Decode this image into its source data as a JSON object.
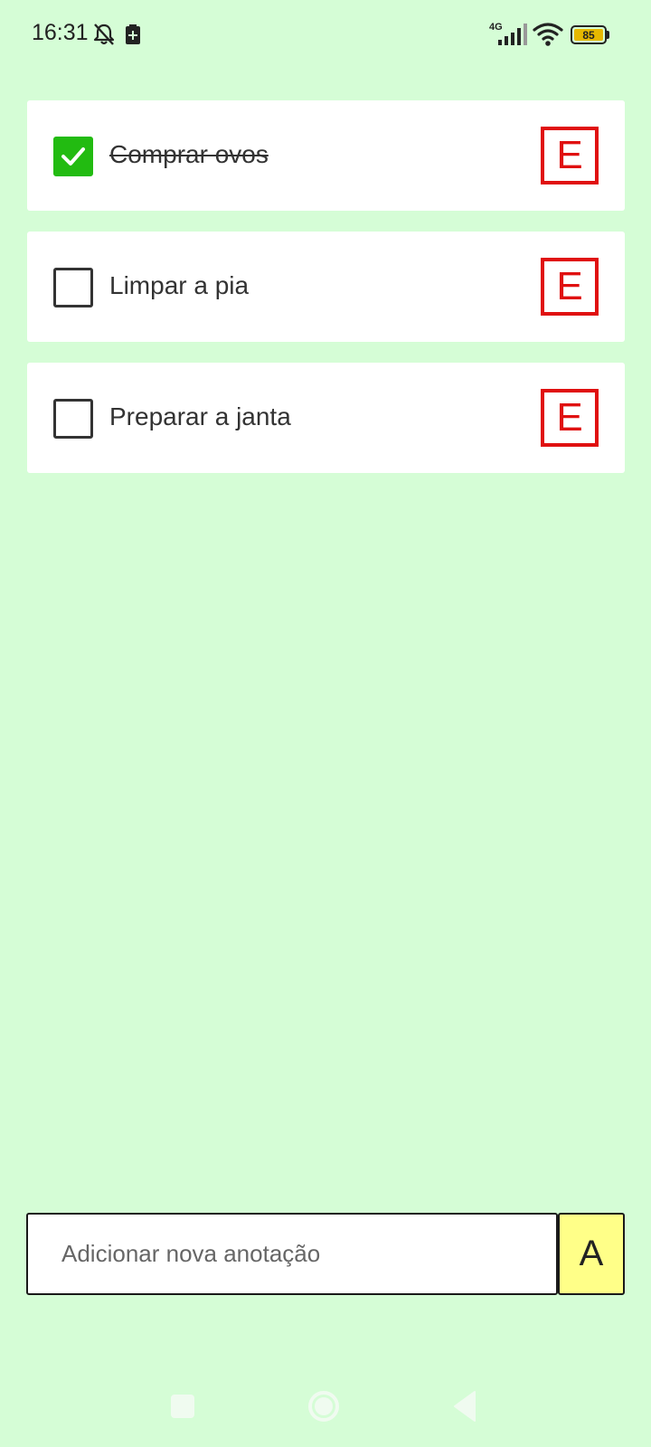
{
  "status_bar": {
    "time": "16:31",
    "network_type": "4G",
    "battery_level": "85",
    "icons": [
      "bell-off-icon",
      "battery-saver-icon",
      "signal-icon",
      "wifi-icon",
      "battery-icon"
    ]
  },
  "tasks": [
    {
      "label": "Comprar ovos",
      "done": true,
      "edit_label": "E"
    },
    {
      "label": "Limpar a pia",
      "done": false,
      "edit_label": "E"
    },
    {
      "label": "Preparar a janta",
      "done": false,
      "edit_label": "E"
    }
  ],
  "new_note": {
    "placeholder": "Adicionar nova anotação",
    "value": "",
    "add_label": "A"
  },
  "colors": {
    "background": "#d5fdd6",
    "checked": "#22bb11",
    "edit_border": "#e01010",
    "add_button": "#ffff88"
  },
  "nav_bar": {
    "icons": [
      "recents-icon",
      "home-icon",
      "back-icon"
    ]
  }
}
